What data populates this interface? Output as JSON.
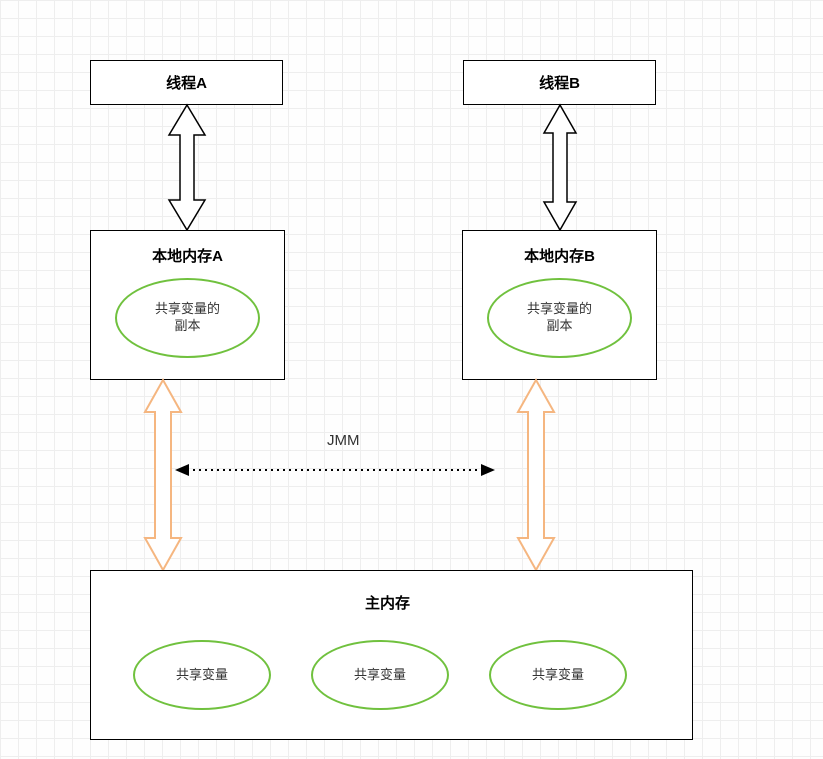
{
  "threadA": {
    "label": "线程A"
  },
  "threadB": {
    "label": "线程B"
  },
  "localA": {
    "title": "本地内存A",
    "copy": "共享变量的\n副本"
  },
  "localB": {
    "title": "本地内存B",
    "copy": "共享变量的\n副本"
  },
  "jmm": {
    "label": "JMM"
  },
  "mainMemory": {
    "title": "主内存",
    "vars": [
      "共享变量",
      "共享变量",
      "共享变量"
    ]
  }
}
